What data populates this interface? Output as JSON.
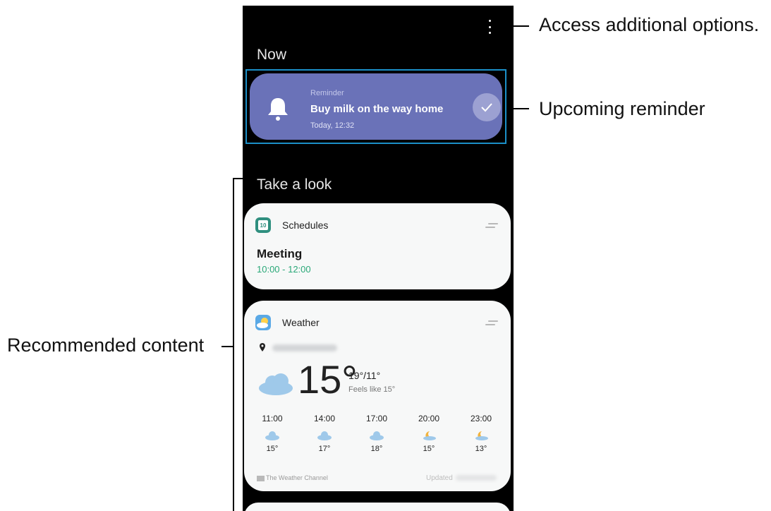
{
  "now_section": {
    "title": "Now"
  },
  "reminder": {
    "label": "Reminder",
    "text": "Buy milk on the way home",
    "time": "Today, 12:32"
  },
  "look_section": {
    "title": "Take a look"
  },
  "schedules": {
    "title": "Schedules",
    "icon_day": "10",
    "event_title": "Meeting",
    "event_time": "10:00 - 12:00"
  },
  "weather": {
    "title": "Weather",
    "current_temp": "15°",
    "high_low": "19°/11°",
    "feels_like": "Feels like 15°",
    "forecast": [
      {
        "time": "11:00",
        "icon": "cloud-icon",
        "temp": "15°"
      },
      {
        "time": "14:00",
        "icon": "cloud-icon",
        "temp": "17°"
      },
      {
        "time": "17:00",
        "icon": "cloud-icon",
        "temp": "18°"
      },
      {
        "time": "20:00",
        "icon": "moon-cloud-icon",
        "temp": "15°"
      },
      {
        "time": "23:00",
        "icon": "moon-cloud-icon",
        "temp": "13°"
      }
    ],
    "source": "The Weather Channel",
    "updated_label": "Updated"
  },
  "callouts": {
    "options": "Access additional options.",
    "reminder": "Upcoming reminder",
    "recommended": "Recommended content"
  },
  "colors": {
    "reminder_bg": "#6a72b8",
    "accent_green": "#2aa878",
    "highlight_border": "#1b8fc7",
    "card_bg": "#f7f8f8"
  }
}
